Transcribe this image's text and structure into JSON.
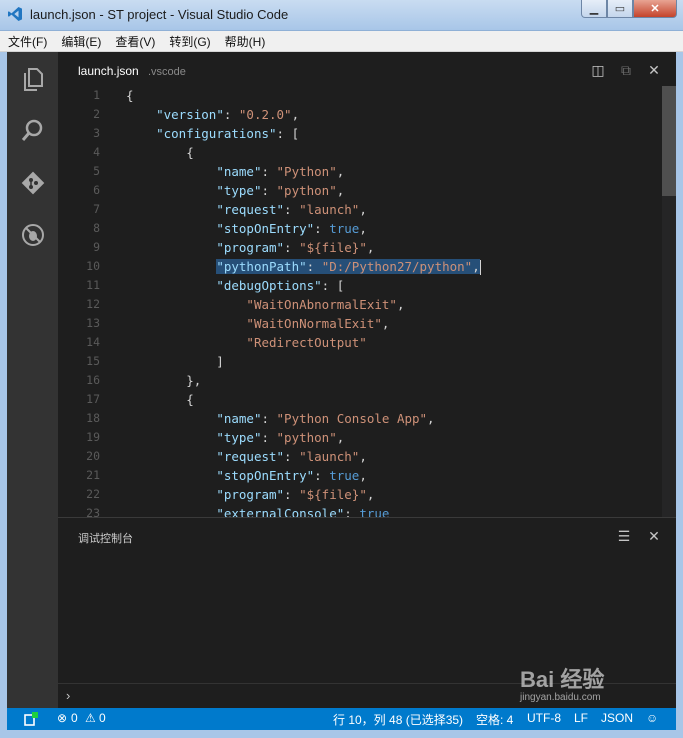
{
  "window": {
    "title": "launch.json - ST project - Visual Studio Code"
  },
  "menu": [
    "文件(F)",
    "编辑(E)",
    "查看(V)",
    "转到(G)",
    "帮助(H)"
  ],
  "tab": {
    "file": "launch.json",
    "folder": ".vscode"
  },
  "editor": {
    "lines": [
      [
        [
          "p",
          "{"
        ]
      ],
      [
        [
          "p",
          "    "
        ],
        [
          "k",
          "\"version\""
        ],
        [
          "p",
          ": "
        ],
        [
          "s",
          "\"0.2.0\""
        ],
        [
          "p",
          ","
        ]
      ],
      [
        [
          "p",
          "    "
        ],
        [
          "k",
          "\"configurations\""
        ],
        [
          "p",
          ": ["
        ]
      ],
      [
        [
          "p",
          "        {"
        ]
      ],
      [
        [
          "p",
          "            "
        ],
        [
          "k",
          "\"name\""
        ],
        [
          "p",
          ": "
        ],
        [
          "s",
          "\"Python\""
        ],
        [
          "p",
          ","
        ]
      ],
      [
        [
          "p",
          "            "
        ],
        [
          "k",
          "\"type\""
        ],
        [
          "p",
          ": "
        ],
        [
          "s",
          "\"python\""
        ],
        [
          "p",
          ","
        ]
      ],
      [
        [
          "p",
          "            "
        ],
        [
          "k",
          "\"request\""
        ],
        [
          "p",
          ": "
        ],
        [
          "s",
          "\"launch\""
        ],
        [
          "p",
          ","
        ]
      ],
      [
        [
          "p",
          "            "
        ],
        [
          "k",
          "\"stopOnEntry\""
        ],
        [
          "p",
          ": "
        ],
        [
          "b",
          "true"
        ],
        [
          "p",
          ","
        ]
      ],
      [
        [
          "p",
          "            "
        ],
        [
          "k",
          "\"program\""
        ],
        [
          "p",
          ": "
        ],
        [
          "s",
          "\"${file}\""
        ],
        [
          "p",
          ","
        ]
      ],
      [
        [
          "p",
          "            "
        ],
        [
          "k sel",
          "\"pythonPath\""
        ],
        [
          "p sel",
          ": "
        ],
        [
          "s sel",
          "\"D:/Python27/python\""
        ],
        [
          "p sel",
          ","
        ],
        [
          "cursor",
          ""
        ]
      ],
      [
        [
          "p",
          "            "
        ],
        [
          "k",
          "\"debugOptions\""
        ],
        [
          "p",
          ": ["
        ]
      ],
      [
        [
          "p",
          "                "
        ],
        [
          "s",
          "\"WaitOnAbnormalExit\""
        ],
        [
          "p",
          ","
        ]
      ],
      [
        [
          "p",
          "                "
        ],
        [
          "s",
          "\"WaitOnNormalExit\""
        ],
        [
          "p",
          ","
        ]
      ],
      [
        [
          "p",
          "                "
        ],
        [
          "s",
          "\"RedirectOutput\""
        ]
      ],
      [
        [
          "p",
          "            ]"
        ]
      ],
      [
        [
          "p",
          "        },"
        ]
      ],
      [
        [
          "p",
          "        {"
        ]
      ],
      [
        [
          "p",
          "            "
        ],
        [
          "k",
          "\"name\""
        ],
        [
          "p",
          ": "
        ],
        [
          "s",
          "\"Python Console App\""
        ],
        [
          "p",
          ","
        ]
      ],
      [
        [
          "p",
          "            "
        ],
        [
          "k",
          "\"type\""
        ],
        [
          "p",
          ": "
        ],
        [
          "s",
          "\"python\""
        ],
        [
          "p",
          ","
        ]
      ],
      [
        [
          "p",
          "            "
        ],
        [
          "k",
          "\"request\""
        ],
        [
          "p",
          ": "
        ],
        [
          "s",
          "\"launch\""
        ],
        [
          "p",
          ","
        ]
      ],
      [
        [
          "p",
          "            "
        ],
        [
          "k",
          "\"stopOnEntry\""
        ],
        [
          "p",
          ": "
        ],
        [
          "b",
          "true"
        ],
        [
          "p",
          ","
        ]
      ],
      [
        [
          "p",
          "            "
        ],
        [
          "k",
          "\"program\""
        ],
        [
          "p",
          ": "
        ],
        [
          "s",
          "\"${file}\""
        ],
        [
          "p",
          ","
        ]
      ],
      [
        [
          "p",
          "            "
        ],
        [
          "k",
          "\"externalConsole\""
        ],
        [
          "p",
          ": "
        ],
        [
          "b",
          "true"
        ]
      ]
    ]
  },
  "panel": {
    "title": "调试控制台",
    "prompt": "›"
  },
  "status": {
    "errors": "0",
    "warnings": "0",
    "position": "行 10，列 48 (已选择35)",
    "indent": "空格: 4",
    "encoding": "UTF-8",
    "eol": "LF",
    "language": "JSON"
  },
  "watermark": {
    "brand": "Bai 经验",
    "url": "jingyan.baidu.com"
  },
  "colors": {
    "accent": "#007acc",
    "selection": "#264f78",
    "key": "#9cdcfe",
    "string": "#ce9178",
    "keyword": "#569cd6"
  }
}
